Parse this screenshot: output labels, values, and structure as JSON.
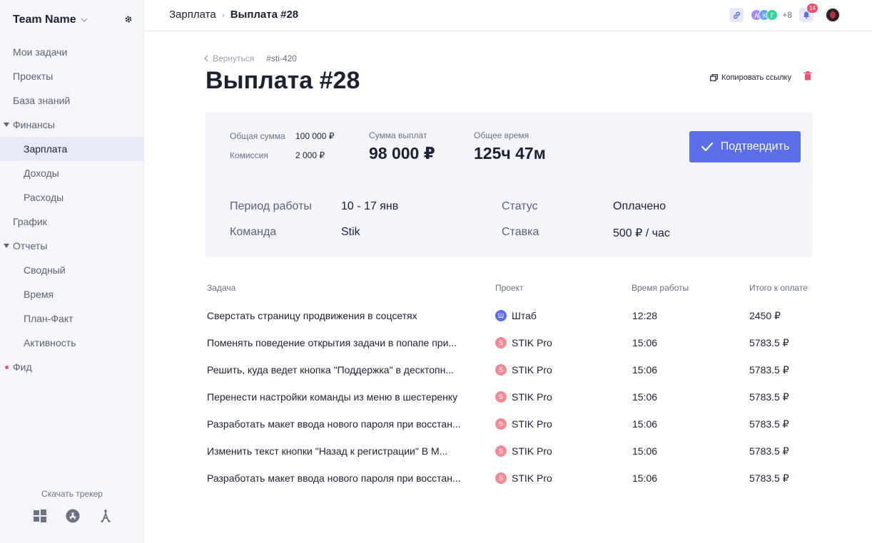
{
  "sidebar": {
    "team_name": "Team Name",
    "items": [
      {
        "label": "Мои задачи"
      },
      {
        "label": "Проекты"
      },
      {
        "label": "База знаний"
      },
      {
        "label": "Финансы"
      },
      {
        "label": "Зарплата"
      },
      {
        "label": "Доходы"
      },
      {
        "label": "Расходы"
      },
      {
        "label": "График"
      },
      {
        "label": "Отчеты"
      },
      {
        "label": "Сводный"
      },
      {
        "label": "Время"
      },
      {
        "label": "План-Факт"
      },
      {
        "label": "Активность"
      },
      {
        "label": "Фид"
      }
    ],
    "download_label": "Скачать трекер"
  },
  "header": {
    "breadcrumb_parent": "Зарплата",
    "breadcrumb_current": "Выплата #28",
    "avatars": [
      {
        "letter": "А",
        "color": "#a78bfa"
      },
      {
        "letter": "К",
        "color": "#60a5fa"
      },
      {
        "letter": "Г",
        "color": "#34d399"
      }
    ],
    "more_count": "+8",
    "notifications": "14"
  },
  "page": {
    "back_label": "Вернуться",
    "code": "#sti-420",
    "title": "Выплата #28",
    "copy_link_label": "Копировать ссылку"
  },
  "summary": {
    "total_label": "Общая сумма",
    "total_value": "100 000 ₽",
    "commission_label": "Комиссия",
    "commission_value": "2 000 ₽",
    "payout_label": "Сумма выплат",
    "payout_value": "98 000 ₽",
    "time_label": "Общее время",
    "time_value": "125ч 47м",
    "confirm_label": "Подтвердить",
    "period_label": "Период работы",
    "period_value": "10 - 17 янв",
    "team_label": "Команда",
    "team_value": "Stik",
    "status_label": "Статус",
    "status_value": "Оплачено",
    "rate_label": "Ставка",
    "rate_value": "500 ₽ / час"
  },
  "table": {
    "headers": [
      "Задача",
      "Проект",
      "Время работы",
      "Итого к оплате"
    ],
    "rows": [
      {
        "task": "Сверстать страницу продвижения в соцсетях",
        "project": "Штаб",
        "project_letter": "Ш",
        "project_color": "#5b6ee8",
        "time": "12:28",
        "total": "2450 ₽"
      },
      {
        "task": "Поменять поведение открытия задачи в попапе при...",
        "project": "STIK Pro",
        "project_letter": "S",
        "project_color": "#f28b95",
        "time": "15:06",
        "total": "5783.5 ₽"
      },
      {
        "task": "Решить, куда ведет кнопка \"Поддержка\" в десктопн...",
        "project": "STIK Pro",
        "project_letter": "S",
        "project_color": "#f28b95",
        "time": "15:06",
        "total": "5783.5 ₽"
      },
      {
        "task": "Перенести настройки команды из меню в шестеренку",
        "project": "STIK Pro",
        "project_letter": "S",
        "project_color": "#f28b95",
        "time": "15:06",
        "total": "5783.5 ₽"
      },
      {
        "task": "Разработать макет ввода нового пароля при восстан...",
        "project": "STIK Pro",
        "project_letter": "S",
        "project_color": "#f28b95",
        "time": "15:06",
        "total": "5783.5 ₽"
      },
      {
        "task": "Изменить текст кнопки \"Назад к регистрации\" В М...",
        "project": "STIK Pro",
        "project_letter": "S",
        "project_color": "#f28b95",
        "time": "15:06",
        "total": "5783.5 ₽"
      },
      {
        "task": "Разработать макет ввода нового пароля при восстан...",
        "project": "STIK Pro",
        "project_letter": "S",
        "project_color": "#f28b95",
        "time": "15:06",
        "total": "5783.5 ₽"
      }
    ]
  }
}
